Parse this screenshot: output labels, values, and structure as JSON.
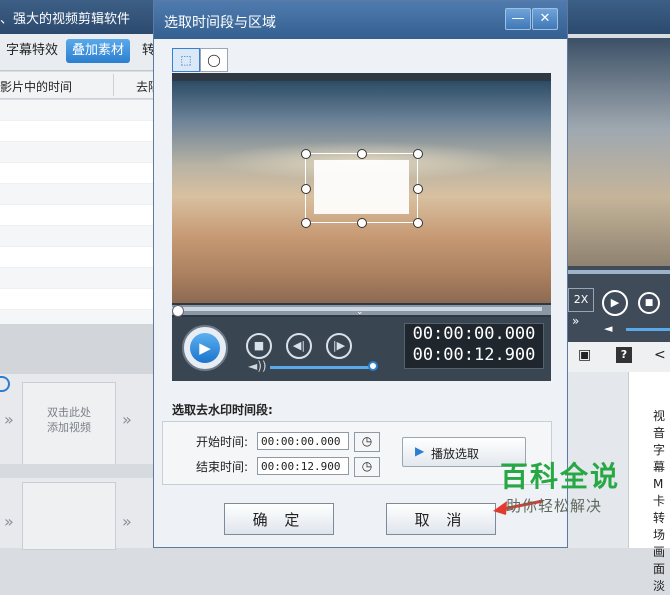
{
  "app": {
    "title": "、强大的视频剪辑软件",
    "tabs": [
      "字幕特效",
      "叠加素材",
      "转"
    ],
    "list_headers": [
      "影片中的时间",
      "去隔"
    ],
    "timeline_slot_text": "双击此处\n添加视频"
  },
  "right_panel": {
    "speed_label": "2X",
    "desc_chars": [
      "视",
      "音",
      "字幕",
      "M",
      "卡",
      "转场",
      "画面",
      "淡"
    ]
  },
  "dialog": {
    "title": "选取时间段与区域",
    "minimize_glyph": "—",
    "close_glyph": "✕",
    "tools": [
      {
        "name": "rect-select",
        "glyph": "⬚",
        "active": true
      },
      {
        "name": "ellipse-select",
        "glyph": "◯",
        "active": false
      }
    ],
    "player": {
      "current_time": "00:00:00.000",
      "total_time": "00:00:12.900",
      "progress": 0.0,
      "volume": 0.95
    },
    "section_label": "选取去水印时间段:",
    "start_label": "开始时间:",
    "start_value": "00:00:00.000",
    "end_label": "结束时间:",
    "end_value": "00:00:12.900",
    "play_selection_label": "播放选取",
    "ok_label": "确 定",
    "cancel_label": "取 消"
  },
  "watermark": {
    "title": "百科全说",
    "subtitle": "助你轻松解决"
  },
  "colors": {
    "accent": "#2c7fd0",
    "dialog_title": "#33608f",
    "watermark_green": "#27a844",
    "arrow_red": "#e23a2e"
  }
}
